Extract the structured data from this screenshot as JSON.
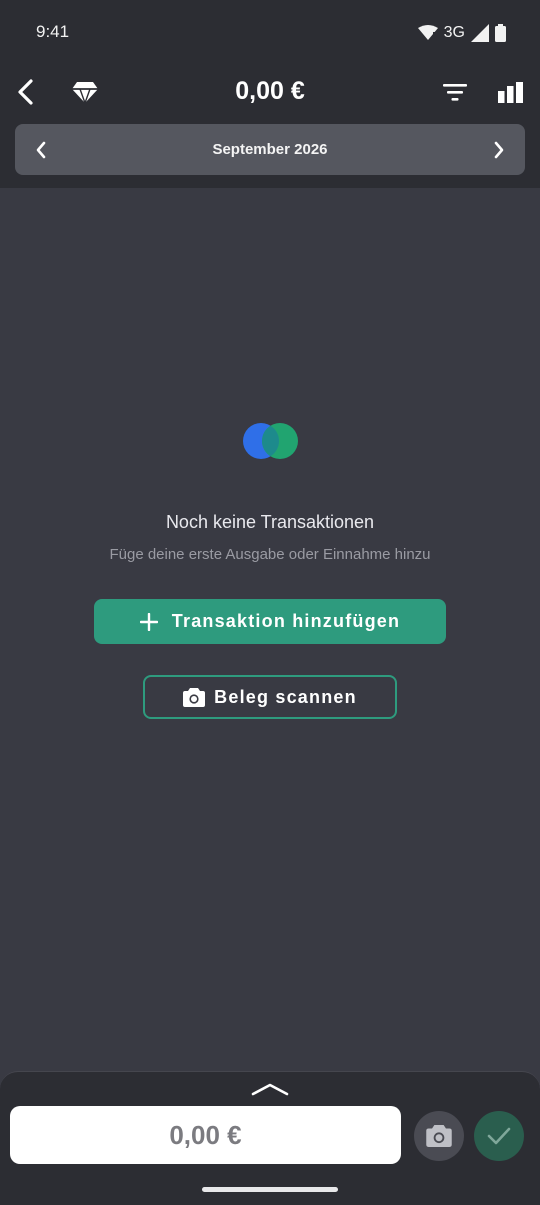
{
  "status": {
    "time": "9:41",
    "network": "3G",
    "icons": [
      "wifi-icon",
      "signal-icon",
      "battery-icon"
    ]
  },
  "appbar": {
    "balance": "0,00 €",
    "icons": [
      "back-arrow-icon",
      "diamond-icon",
      "filter-icon",
      "bar-chart-icon"
    ]
  },
  "month": {
    "label": "September 2026",
    "icons": [
      "chevron-left-icon",
      "chevron-right-icon"
    ]
  },
  "empty_state": {
    "title": "Noch keine Transaktionen",
    "subtitle": "Füge deine erste Ausgabe oder Einnahme hinzu",
    "add_button_label": "Transaktion hinzufügen",
    "scan_button_label": "Beleg scannen",
    "colors": {
      "blue": "#2f6fe8",
      "green": "#1fae74",
      "accent": "#2e9b7e"
    }
  },
  "bottom_sheet": {
    "amount_value": "0,00 €",
    "icons": [
      "chevron-up-icon",
      "camera-icon",
      "check-icon"
    ]
  }
}
